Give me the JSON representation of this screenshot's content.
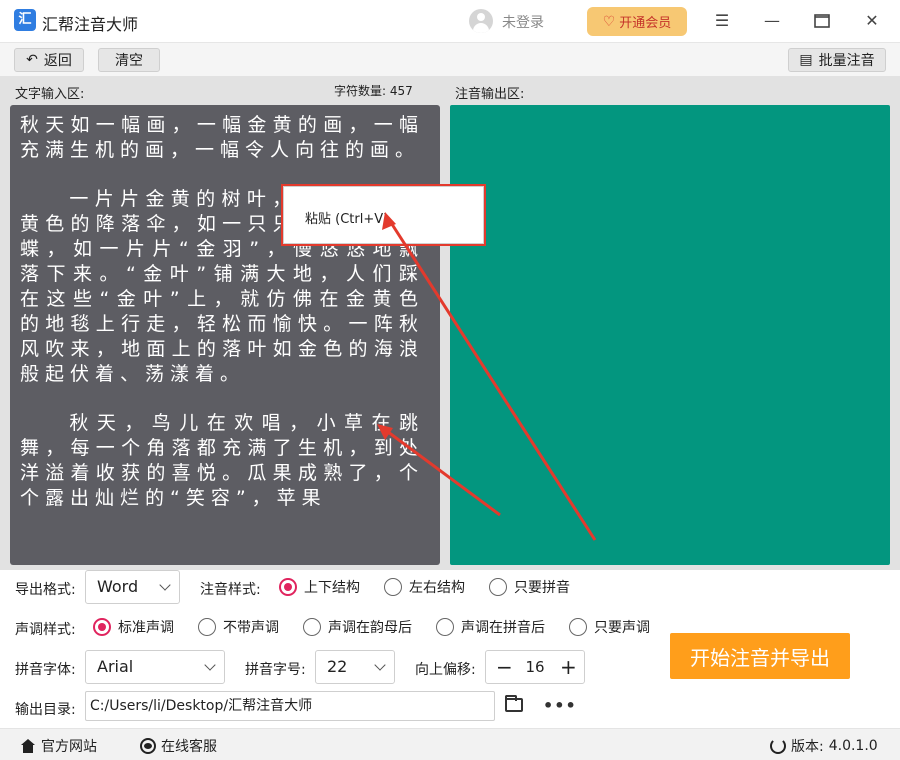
{
  "app": {
    "title": "汇帮注音大师",
    "logo": "汇",
    "login_text": "未登录",
    "vip_label": "开通会员"
  },
  "toolbar": {
    "back_label": "返回",
    "clear_label": "清空",
    "batch_label": "批量注音"
  },
  "input_panel": {
    "label": "文字输入区:",
    "char_count_label": "字符数量: 457",
    "paragraphs": [
      "秋天如一幅画，一幅金黄的画，一幅充满生机的画，一幅令人向往的画。",
      "一片片金黄的树叶，像一把把金黄色的降落伞，如一只只金黄色的蝴蝶，如一片片“金羽”，慢悠悠地飘落下来。“金叶”铺满大地，人们踩在这些“金叶”上，就仿佛在金黄色的地毯上行走，轻松而愉快。一阵秋风吹来，地面上的落叶如金色的海浪般起伏着、荡漾着。",
      "秋天，鸟儿在欢唱，小草在跳舞，每一个角落都充满了生机，到处洋溢着收获的喜悦。瓜果成熟了，个个露出灿烂的“笑容”，苹果"
    ]
  },
  "output_panel": {
    "label": "注音输出区:",
    "bg_color": "#03967f"
  },
  "context_menu": {
    "paste_label": "粘贴 (Ctrl+V)"
  },
  "settings": {
    "export_format": {
      "label": "导出格式:",
      "value": "Word"
    },
    "pinyin_style": {
      "label": "注音样式:",
      "options": [
        "上下结构",
        "左右结构",
        "只要拼音"
      ],
      "selected": 0
    },
    "tone_style": {
      "label": "声调样式:",
      "options": [
        "标准声调",
        "不带声调",
        "声调在韵母后",
        "声调在拼音后",
        "只要声调"
      ],
      "selected": 0
    },
    "pinyin_font": {
      "label": "拼音字体:",
      "value": "Arial"
    },
    "pinyin_size": {
      "label": "拼音字号:",
      "value": "22"
    },
    "offset": {
      "label": "向上偏移:",
      "value": "16",
      "minus": "−",
      "plus": "+"
    },
    "output_dir": {
      "label": "输出目录:",
      "value": "C:/Users/li/Desktop/汇帮注音大师"
    },
    "start_label": "开始注音并导出"
  },
  "footer": {
    "website_label": "官方网站",
    "service_label": "在线客服",
    "version_label": "版本:",
    "version": "4.0.1.0"
  },
  "colors": {
    "accent_orange": "#ff9e1b",
    "radio_pink": "#e0245e",
    "annotation_red": "#e33a2d"
  }
}
